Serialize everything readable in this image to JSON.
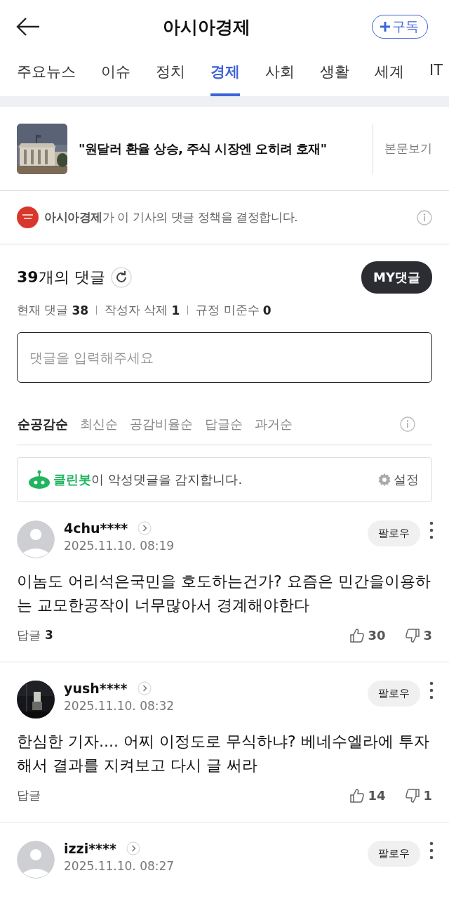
{
  "header": {
    "title": "아시아경제",
    "subscribe": "구독"
  },
  "tabs": [
    {
      "label": "주요뉴스",
      "selected": false
    },
    {
      "label": "이슈",
      "selected": false
    },
    {
      "label": "정치",
      "selected": false
    },
    {
      "label": "경제",
      "selected": true
    },
    {
      "label": "사회",
      "selected": false
    },
    {
      "label": "생활",
      "selected": false
    },
    {
      "label": "세계",
      "selected": false
    },
    {
      "label": "IT",
      "selected": false
    }
  ],
  "article": {
    "headline": "\"원달러 환율 상승, 주식 시장엔 오히려 호재\"",
    "view_link": "본문보기"
  },
  "policy_notice": "**아시아경제**가 이 기사의 댓글 정책을 결정합니다.",
  "comment_count": "**39**개의 댓글",
  "my_comments_button": "MY댓글",
  "stats": [
    {
      "label": "현재 댓글",
      "value": "38"
    },
    {
      "label": "작성자 삭제",
      "value": "1"
    },
    {
      "label": "규정 미준수",
      "value": "0"
    }
  ],
  "comment_input": {
    "placeholder": "댓글을 입력해주세요"
  },
  "sort_tabs": [
    {
      "label": "순공감순",
      "selected": true
    },
    {
      "label": "최신순",
      "selected": false
    },
    {
      "label": "공감비율순",
      "selected": false
    },
    {
      "label": "답글순",
      "selected": false
    },
    {
      "label": "과거순",
      "selected": false
    }
  ],
  "cleanbot": {
    "notice": "**클린봇**이 악성댓글을 감지합니다.",
    "settings": "설정"
  },
  "comments": [
    {
      "avatar": {
        "kind": "default"
      },
      "user": "4chu****",
      "date": "2025.11.10. 08:19",
      "follow": "팔로우",
      "body": "이놈도 어리석은국민을 호도하는건가? 요즘은 민간을이용하는 교모한공작이 너무많아서 경계해야한다",
      "reply_label": "답글",
      "reply_count": "3",
      "likes": "30",
      "dislikes": "3"
    },
    {
      "user": "yush****",
      "date": "2025.11.10. 08:32",
      "follow": "팔로우",
      "body": "한심한 기자.... 어찌 이정도로 무식하냐? 베네수엘라에 투자해서 결과를 지켜보고 다시 글 써라",
      "reply_label": "답글",
      "likes": "14",
      "dislikes": "1"
    },
    {
      "avatar": {
        "kind": "default"
      },
      "user": "izzi****",
      "date": "2025.11.10. 08:27",
      "follow": "팔로우"
    }
  ]
}
